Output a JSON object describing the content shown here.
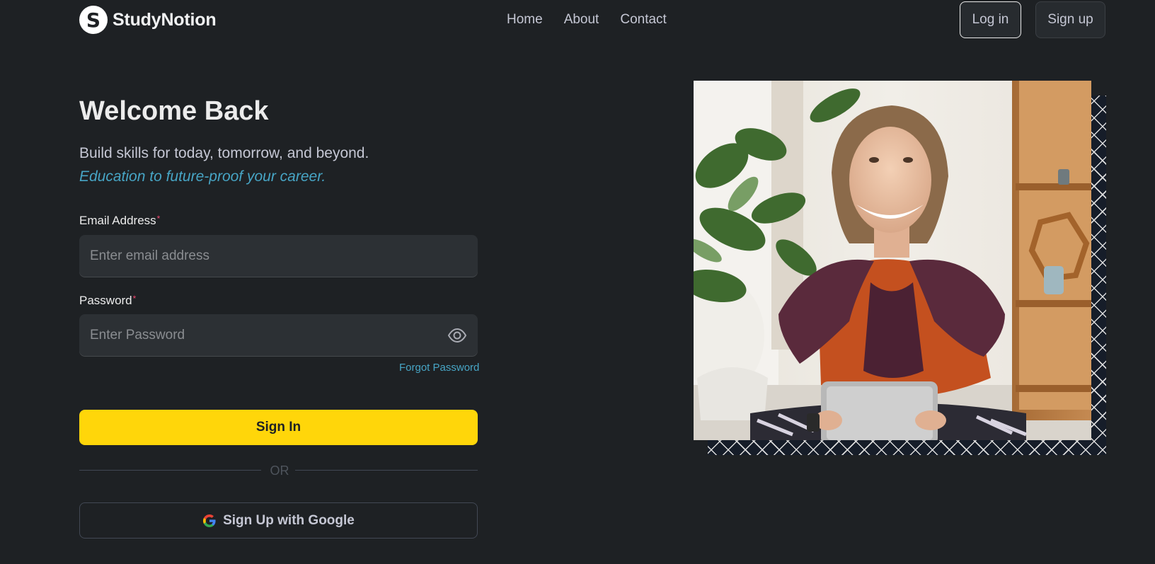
{
  "brand": {
    "name": "StudyNotion",
    "mark": "S"
  },
  "nav": {
    "links": [
      "Home",
      "About",
      "Contact"
    ],
    "login_label": "Log in",
    "signup_label": "Sign up"
  },
  "hero": {
    "title": "Welcome Back",
    "subtitle": "Build skills for today, tomorrow, and beyond.",
    "tagline": "Education to future-proof your career."
  },
  "form": {
    "email_label": "Email Address",
    "email_placeholder": "Enter email address",
    "password_label": "Password",
    "password_placeholder": "Enter Password",
    "required_mark": "*",
    "forgot_label": "Forgot Password",
    "signin_label": "Sign In",
    "or_text": "OR",
    "google_label": "Sign Up with Google"
  },
  "icons": {
    "eye": "eye-icon",
    "google": "google-icon"
  },
  "colors": {
    "background": "#1e2124",
    "accent_yellow": "#ffd60a",
    "link_blue": "#47a5c5",
    "required_red": "#ef476f"
  }
}
